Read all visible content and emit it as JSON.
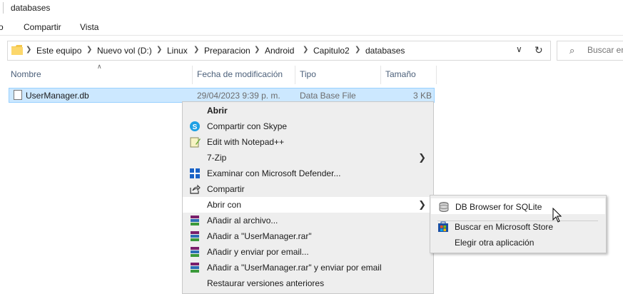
{
  "window": {
    "title": "databases"
  },
  "ribbon": {
    "tabs": [
      "o",
      "Compartir",
      "Vista"
    ]
  },
  "address": {
    "crumbs": [
      "Este equipo",
      "Nuevo vol (D:)",
      "Linux",
      "Preparacion",
      "Android",
      "Capitulo2",
      "databases"
    ]
  },
  "search": {
    "placeholder": "Buscar en"
  },
  "columns": {
    "name": "Nombre",
    "modified": "Fecha de modificación",
    "type": "Tipo",
    "size": "Tamaño"
  },
  "file": {
    "name": "UserManager.db",
    "modified": "29/04/2023 9:39 p. m.",
    "type": "Data Base File",
    "size": "3 KB"
  },
  "context_menu": {
    "items": [
      {
        "label": "Abrir",
        "icon": "none"
      },
      {
        "label": "Compartir con Skype",
        "icon": "skype-icon"
      },
      {
        "label": "Edit with Notepad++",
        "icon": "notepad-icon"
      },
      {
        "label": "7-Zip",
        "icon": "none",
        "submenu": true
      },
      {
        "label": "Examinar con Microsoft Defender...",
        "icon": "defender-icon"
      },
      {
        "label": "Compartir",
        "icon": "share-icon"
      },
      {
        "label": "Abrir con",
        "icon": "none",
        "submenu": true
      },
      {
        "label": "Añadir al archivo...",
        "icon": "winrar-icon"
      },
      {
        "label": "Añadir a \"UserManager.rar\"",
        "icon": "winrar-icon"
      },
      {
        "label": "Añadir y enviar por email...",
        "icon": "winrar-icon"
      },
      {
        "label": "Añadir a \"UserManager.rar\" y enviar por email",
        "icon": "winrar-icon"
      },
      {
        "label": "Restaurar versiones anteriores",
        "icon": "none"
      }
    ]
  },
  "open_with_menu": {
    "items": [
      {
        "label": "DB Browser for SQLite",
        "icon": "sqlite-icon"
      },
      {
        "label": "Buscar en Microsoft Store",
        "icon": "store-icon"
      },
      {
        "label": "Elegir otra aplicación",
        "icon": "none"
      }
    ]
  },
  "colors": {
    "selection": "#cce8ff",
    "menu_bg": "#eeeeee",
    "header_text": "#4c607a"
  }
}
